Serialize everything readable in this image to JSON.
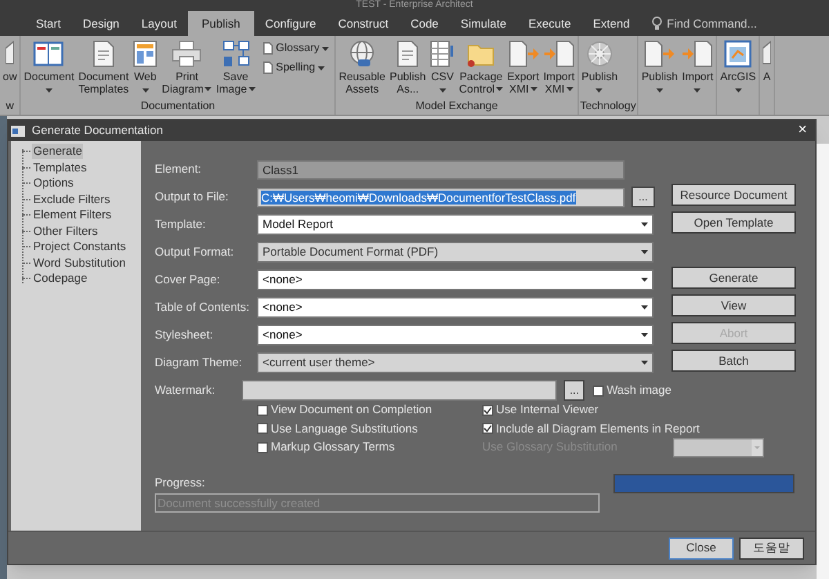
{
  "app_title": "TEST - Enterprise Architect",
  "tabs": [
    {
      "label": "Start",
      "selected": false
    },
    {
      "label": "Design",
      "selected": false
    },
    {
      "label": "Layout",
      "selected": false
    },
    {
      "label": "Publish",
      "selected": true
    },
    {
      "label": "Configure",
      "selected": false
    },
    {
      "label": "Construct",
      "selected": false
    },
    {
      "label": "Code",
      "selected": false
    },
    {
      "label": "Simulate",
      "selected": false
    },
    {
      "label": "Execute",
      "selected": false
    },
    {
      "label": "Extend",
      "selected": false
    }
  ],
  "find_command": {
    "placeholder": "Find Command..."
  },
  "ribbon": {
    "groups": [
      {
        "label": "w",
        "items": [
          {
            "kind": "cut",
            "lines": [
              "ow"
            ],
            "dropdown": false
          }
        ]
      },
      {
        "label": "Documentation",
        "items": [
          {
            "kind": "book",
            "lines": [
              "Document"
            ],
            "dropdown": true
          },
          {
            "kind": "page",
            "lines": [
              "Document",
              "Templates"
            ],
            "dropdown": false
          },
          {
            "kind": "web",
            "lines": [
              "Web"
            ],
            "dropdown": true
          },
          {
            "kind": "printer",
            "lines": [
              "Print",
              "Diagram"
            ],
            "dropdown": true
          },
          {
            "kind": "image",
            "lines": [
              "Save",
              "Image"
            ],
            "dropdown": true
          },
          {
            "kind": "small",
            "entries": [
              {
                "label": "Glossary",
                "dropdown": true
              },
              {
                "label": "Spelling",
                "dropdown": true
              }
            ]
          }
        ]
      },
      {
        "label": "Model Exchange",
        "items": [
          {
            "kind": "globe",
            "lines": [
              "Reusable",
              "Assets"
            ],
            "dropdown": false
          },
          {
            "kind": "page",
            "lines": [
              "Publish",
              "As..."
            ],
            "dropdown": false
          },
          {
            "kind": "sheet",
            "lines": [
              "CSV"
            ],
            "dropdown": true
          },
          {
            "kind": "folder",
            "lines": [
              "Package",
              "Control"
            ],
            "dropdown": true
          },
          {
            "kind": "export",
            "lines": [
              "Export",
              "XMI"
            ],
            "dropdown": true
          },
          {
            "kind": "import",
            "lines": [
              "Import",
              "XMI"
            ],
            "dropdown": true
          }
        ]
      },
      {
        "label": "Technology",
        "items": [
          {
            "kind": "gear",
            "lines": [
              "Publish"
            ],
            "dropdown": true
          }
        ]
      },
      {
        "items": [
          {
            "kind": "export",
            "lines": [
              "Publish"
            ],
            "dropdown": true
          },
          {
            "kind": "import",
            "lines": [
              "Import"
            ],
            "dropdown": true
          }
        ]
      },
      {
        "items": [
          {
            "kind": "arcgis",
            "lines": [
              "ArcGIS"
            ],
            "dropdown": true
          }
        ]
      },
      {
        "items": [
          {
            "kind": "cut",
            "lines": [
              "A"
            ],
            "dropdown": false
          }
        ]
      }
    ]
  },
  "dialog": {
    "title": "Generate Documentation",
    "close": "×",
    "tree": [
      {
        "label": "Generate",
        "selected": true
      },
      {
        "label": "Templates",
        "selected": false
      },
      {
        "label": "Options",
        "selected": false
      },
      {
        "label": "Exclude Filters",
        "selected": false
      },
      {
        "label": "Element Filters",
        "selected": false
      },
      {
        "label": "Other Filters",
        "selected": false
      },
      {
        "label": "Project Constants",
        "selected": false
      },
      {
        "label": "Word Substitution",
        "selected": false
      },
      {
        "label": "Codepage",
        "selected": false
      }
    ],
    "fields": [
      {
        "kind": "text",
        "label": "Element:",
        "value": "Class1",
        "disabled": true
      },
      {
        "kind": "path",
        "label": "Output to File:",
        "value": "C:₩Users₩heomi₩Downloads₩DocumentforTestClass.pdf",
        "text_selected": true,
        "browse": "..."
      },
      {
        "kind": "select",
        "label": "Template:",
        "value": "Model Report",
        "disabled": false
      },
      {
        "kind": "select",
        "label": "Output Format:",
        "value": "Portable Document Format (PDF)",
        "disabled": true
      },
      {
        "kind": "select",
        "label": "Cover Page:",
        "value": "<none>",
        "disabled": false
      },
      {
        "kind": "select",
        "label": "Table of Contents:",
        "value": "<none>",
        "disabled": false
      },
      {
        "kind": "select",
        "label": "Stylesheet:",
        "value": "<none>",
        "disabled": false
      },
      {
        "kind": "select",
        "label": "Diagram Theme:",
        "value": "<current user theme>",
        "disabled": true
      },
      {
        "kind": "watermark",
        "label": "Watermark:",
        "browse": "...",
        "wash": {
          "label": "Wash image",
          "checked": false
        }
      }
    ],
    "options": [
      {
        "label": "View Document on Completion",
        "checked": false
      },
      {
        "label": "Use Internal Viewer",
        "checked": true
      },
      {
        "label": "Use Language Substitutions",
        "checked": false
      },
      {
        "label": "Include all Diagram Elements in Report",
        "checked": true
      },
      {
        "label": "Markup Glossary Terms",
        "checked": false
      }
    ],
    "glossary_substitution": {
      "label": "Use Glossary Substitution",
      "disabled": true
    },
    "button_groups": [
      [
        {
          "label": "Resource Document",
          "disabled": false
        },
        {
          "label": "Open Template",
          "disabled": false
        }
      ],
      [
        {
          "label": "Generate",
          "disabled": false
        },
        {
          "label": "View",
          "disabled": false
        },
        {
          "label": "Abort",
          "disabled": true
        },
        {
          "label": "Batch",
          "disabled": false
        }
      ]
    ],
    "progress": {
      "label": "Progress:",
      "status": "Document successfully created",
      "level": 1
    },
    "footer_buttons": [
      {
        "label": "Close",
        "focused": true
      },
      {
        "label": "도움말",
        "focused": false
      }
    ]
  }
}
